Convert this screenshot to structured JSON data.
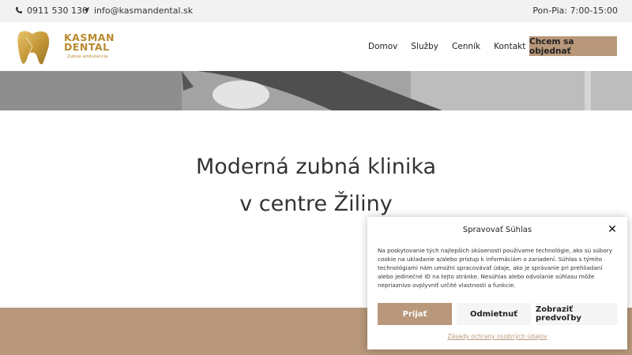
{
  "topbar": {
    "phone": "0911 530 130",
    "email": "info@kasmandental.sk",
    "hours": "Pon-Pia: 7:00-15:00",
    "phone_icon": "phone-icon",
    "email_icon": "paper-plane-icon"
  },
  "header": {
    "logo": {
      "line1": "KASMAN",
      "line2": "DENTAL",
      "sub": "Zubná ambulancia"
    },
    "nav": [
      "Domov",
      "Služby",
      "Cenník",
      "Kontakt"
    ],
    "cta_label": "Chcem sa objednať"
  },
  "hero": {
    "heading_line1": "Moderná zubná klinika",
    "heading_line2": "v centre Žiliny"
  },
  "consent": {
    "title": "Spravovať Súhlas",
    "body": "Na poskytovanie tých najlepších skúseností používame technológie, ako sú súbory cookie na ukladanie a/alebo prístup k informáciám o zariadení. Súhlas s týmito technológiami nám umožní spracovávať údaje, ako je správanie pri prehliadaní alebo jedinečné ID na tejto stránke. Nesúhlas alebo odvolanie súhlasu môže nepriaznivo ovplyvniť určité vlastnosti a funkcie.",
    "accept_label": "Prijať",
    "deny_label": "Odmietnuť",
    "prefs_label": "Zobraziť predvoľby",
    "policy_link": "Zásady ochrany osobných údajov"
  },
  "colors": {
    "accent": "#b8977a",
    "gold": "#b98a2e",
    "topbar_bg": "#f2f2f2"
  }
}
